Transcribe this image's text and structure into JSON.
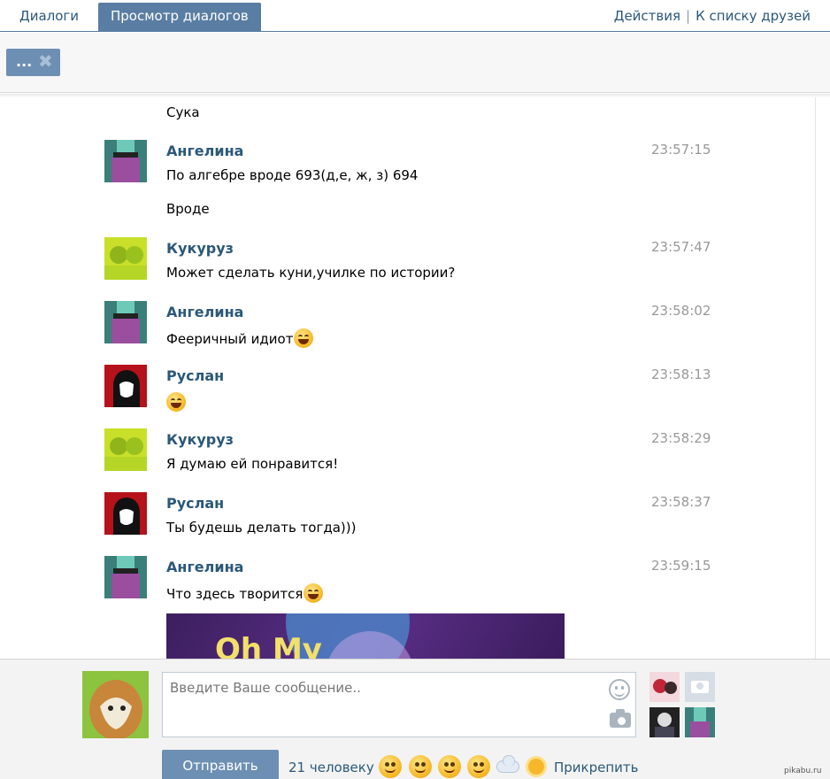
{
  "tabs": [
    {
      "label": "Диалоги"
    },
    {
      "label": "Просмотр диалогов"
    }
  ],
  "top_links": {
    "actions": "Действия",
    "separator": "|",
    "friends": "К списку друзей"
  },
  "toolbar": {
    "dots": "...",
    "close": "✖"
  },
  "messages": [
    {
      "author": "",
      "time": "",
      "text": "Сука"
    },
    {
      "author": "Ангелина",
      "time": "23:57:15",
      "text": "По алгебре вроде 693(д,е, ж, з) 694"
    },
    {
      "author": "",
      "time": "",
      "text": "Вроде"
    },
    {
      "author": "Кукуруз",
      "time": "23:57:47",
      "text": "Может сделать куни,училке по истории?"
    },
    {
      "author": "Ангелина",
      "time": "23:58:02",
      "text": "Фееричный идиот"
    },
    {
      "author": "Руслан",
      "time": "23:58:13",
      "text": ""
    },
    {
      "author": "Кукуруз",
      "time": "23:58:29",
      "text": "Я думаю ей понравится!"
    },
    {
      "author": "Руслан",
      "time": "23:58:37",
      "text": "Ты будешь делать тогда)))"
    },
    {
      "author": "Ангелина",
      "time": "23:59:15",
      "text": "Что здесь творится"
    }
  ],
  "image_caption": "Oh My",
  "compose": {
    "placeholder": "Введите Ваше сообщение..",
    "send_label": "Отправить",
    "people_count": "21 человеку",
    "attach_label": "Прикрепить"
  },
  "watermark": "pikabu.ru",
  "colors": {
    "accent": "#597da3",
    "button": "#6d8fb3",
    "link": "#2b587a",
    "time": "#999999"
  }
}
